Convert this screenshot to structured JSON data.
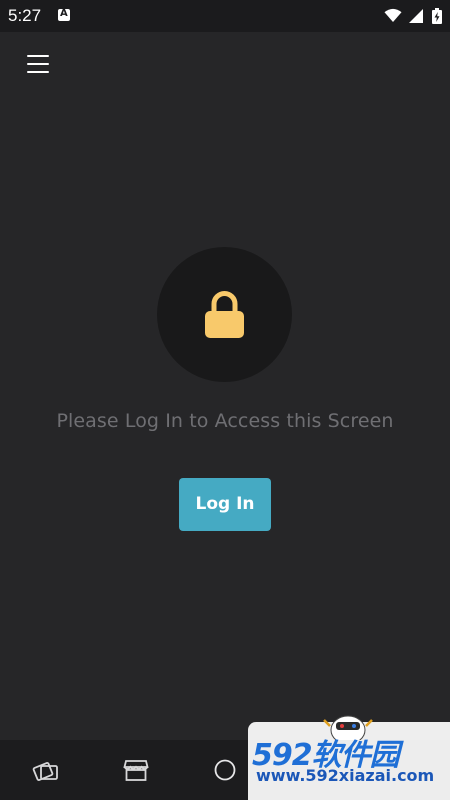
{
  "status_bar": {
    "time": "5:27",
    "notification_icon": "a-badge-icon",
    "wifi_icon": "wifi-icon",
    "signal_icon": "signal-icon",
    "battery_icon": "battery-charging-icon"
  },
  "header": {
    "menu_icon": "hamburger-menu-icon"
  },
  "main": {
    "lock_icon": "lock-icon",
    "message": "Please Log In to Access this Screen",
    "login_label": "Log In"
  },
  "bottom_nav": {
    "items": [
      {
        "icon": "cards-icon"
      },
      {
        "icon": "store-icon"
      },
      {
        "icon": "home-circle-icon"
      }
    ]
  },
  "watermark": {
    "title": "592软件园",
    "url": "www.592xiazai.com"
  },
  "colors": {
    "background": "#262628",
    "accent": "#45aac3",
    "lock": "#f8c96b",
    "message_text": "#6f6f73"
  }
}
